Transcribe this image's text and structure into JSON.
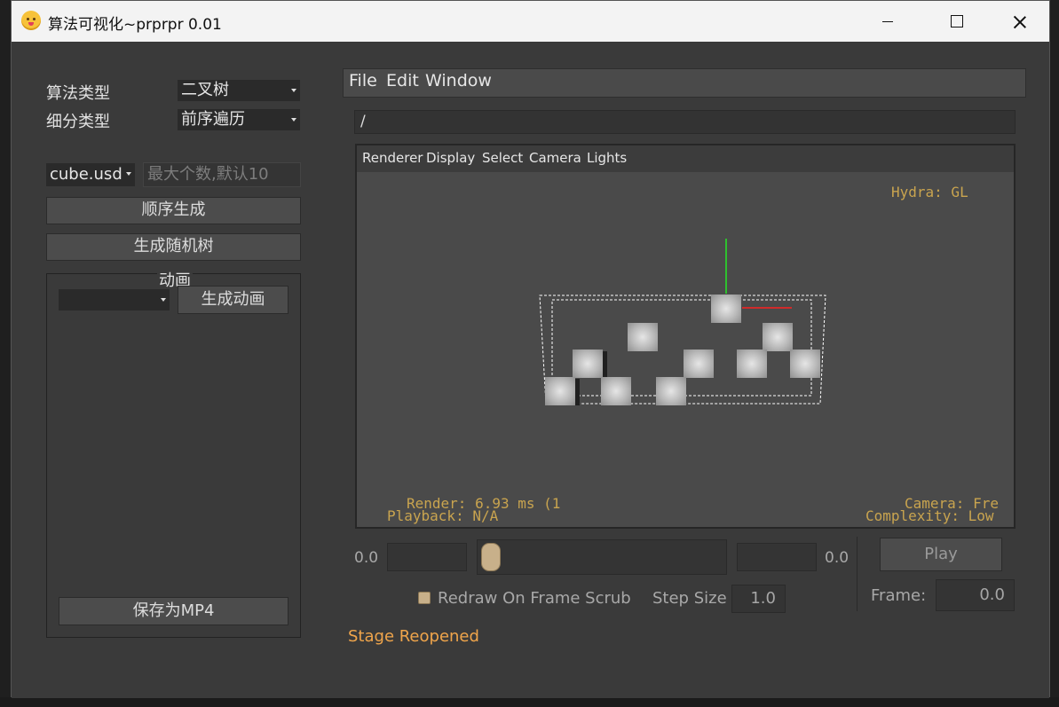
{
  "app": {
    "title": "算法可视化~prprpr 0.01"
  },
  "controls": {
    "algo_type_label": "算法类型",
    "algo_type_value": "二叉树",
    "sub_type_label": "细分类型",
    "sub_type_value": "前序遍历",
    "shape_value": "cube.usd",
    "max_count_placeholder": "最大个数,默认10",
    "seq_gen_label": "顺序生成",
    "random_tree_label": "生成随机树",
    "animation_group_label": "动画",
    "animation_select_value": "",
    "gen_animation_label": "生成动画",
    "save_mp4_label": "保存为MP4"
  },
  "usdview": {
    "menu": [
      "File",
      "Edit",
      "Window"
    ],
    "path": "/",
    "viewport_menu": [
      "Renderer",
      "Display",
      "Select",
      "Camera",
      "Lights"
    ],
    "hud": {
      "renderer": "Hydra: GL",
      "render_time": "Render: 6.93 ms (1",
      "playback": "Playback: N/A",
      "camera": "Camera: Fre",
      "complexity": "Complexity: Low"
    },
    "timeline": {
      "start_value": "0.0",
      "end_value": "0.0",
      "start_field": "",
      "end_field": "",
      "slider_position": 0.0
    },
    "play_label": "Play",
    "frame_label": "Frame:",
    "frame_value": "0.0",
    "redraw_label": "Redraw On Frame Scrub",
    "redraw_checked": false,
    "step_size_label": "Step Size",
    "step_size_value": "1.0",
    "status": "Stage Reopened"
  },
  "colors": {
    "accent_orange": "#f0a54b",
    "hud_text": "#c9a44f",
    "axis_x": "#d02a2a",
    "axis_y": "#2ec02e",
    "axis_z": "#2a5ad0"
  }
}
